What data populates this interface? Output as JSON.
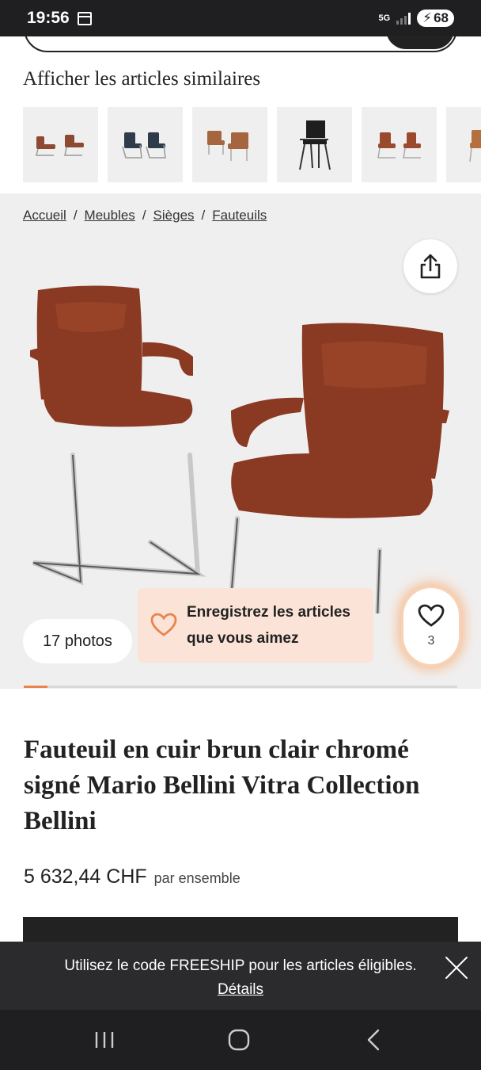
{
  "status_bar": {
    "time": "19:56",
    "network": "5G",
    "battery": "68"
  },
  "similar": {
    "title": "Afficher les articles similaires",
    "thumb_count": 6
  },
  "breadcrumb": {
    "items": [
      "Accueil",
      "Meubles",
      "Sièges",
      "Fauteuils"
    ],
    "separator": "/"
  },
  "gallery": {
    "photos_label": "17 photos",
    "save_tip": "Enregistrez les articles que vous aimez",
    "favorites_count": "3",
    "progress": 0.055
  },
  "product": {
    "title": "Fauteuil en cuir brun clair chromé signé Mario Bellini Vitra Collection Bellini",
    "price": "5 632,44 CHF",
    "price_unit": "par ensemble"
  },
  "promo": {
    "text": "Utilisez le code FREESHIP pour les articles éligibles.",
    "link": "Détails"
  },
  "icons": {
    "share": "share-icon",
    "heart": "heart-icon",
    "close": "close-icon",
    "recents": "recents-icon",
    "home": "home-icon",
    "back": "back-icon"
  },
  "colors": {
    "accent": "#e8844d",
    "tip_bg": "#fbe3d7",
    "dark": "#222222",
    "leather": "#8a3a22"
  }
}
